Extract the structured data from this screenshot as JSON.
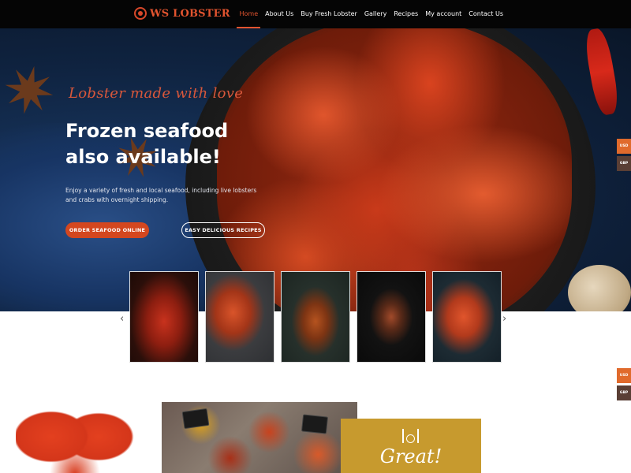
{
  "header": {
    "logo_text": "WS LOBSTER",
    "nav": [
      {
        "label": "Home",
        "active": true
      },
      {
        "label": "About Us"
      },
      {
        "label": "Buy Fresh Lobster"
      },
      {
        "label": "Gallery"
      },
      {
        "label": "Recipes"
      },
      {
        "label": "My account"
      },
      {
        "label": "Contact Us"
      }
    ]
  },
  "hero": {
    "script": "Lobster made with love",
    "headline": "Frozen seafood also available!",
    "description": "Enjoy a variety of fresh and local seafood, including live lobsters and crabs with overnight shipping.",
    "primary_button": "ORDER SEAFOOD ONLINE",
    "secondary_button": "EASY DELICIOUS RECIPES"
  },
  "carousel": {
    "prev": "‹",
    "next": "›"
  },
  "currency": {
    "usd": "USD",
    "gbp": "GBP"
  },
  "promo": {
    "great": "Great!"
  },
  "colors": {
    "accent": "#d4471f",
    "gold": "#c79a2e"
  }
}
